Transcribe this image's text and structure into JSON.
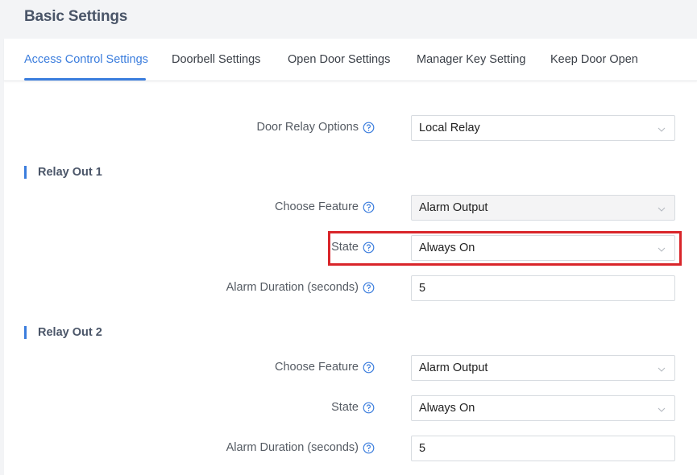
{
  "header": {
    "title": "Basic Settings"
  },
  "tabs": [
    {
      "label": "Access Control Settings",
      "active": true
    },
    {
      "label": "Doorbell Settings"
    },
    {
      "label": "Open Door Settings"
    },
    {
      "label": "Manager Key Setting"
    },
    {
      "label": "Keep Door Open"
    }
  ],
  "door_relay": {
    "label": "Door Relay Options",
    "value": "Local Relay"
  },
  "relay_out_1": {
    "title": "Relay Out 1",
    "choose_feature": {
      "label": "Choose Feature",
      "value": "Alarm Output"
    },
    "state": {
      "label": "State",
      "value": "Always On"
    },
    "alarm_duration": {
      "label": "Alarm Duration (seconds)",
      "value": "5"
    }
  },
  "relay_out_2": {
    "title": "Relay Out 2",
    "choose_feature": {
      "label": "Choose Feature",
      "value": "Alarm Output"
    },
    "state": {
      "label": "State",
      "value": "Always On"
    },
    "alarm_duration": {
      "label": "Alarm Duration (seconds)",
      "value": "5"
    }
  },
  "colors": {
    "accent": "#3b7ddd",
    "highlight": "#d9252a"
  },
  "icons": {
    "help": "question-circle-icon",
    "dropdown": "chevron-down-icon"
  }
}
